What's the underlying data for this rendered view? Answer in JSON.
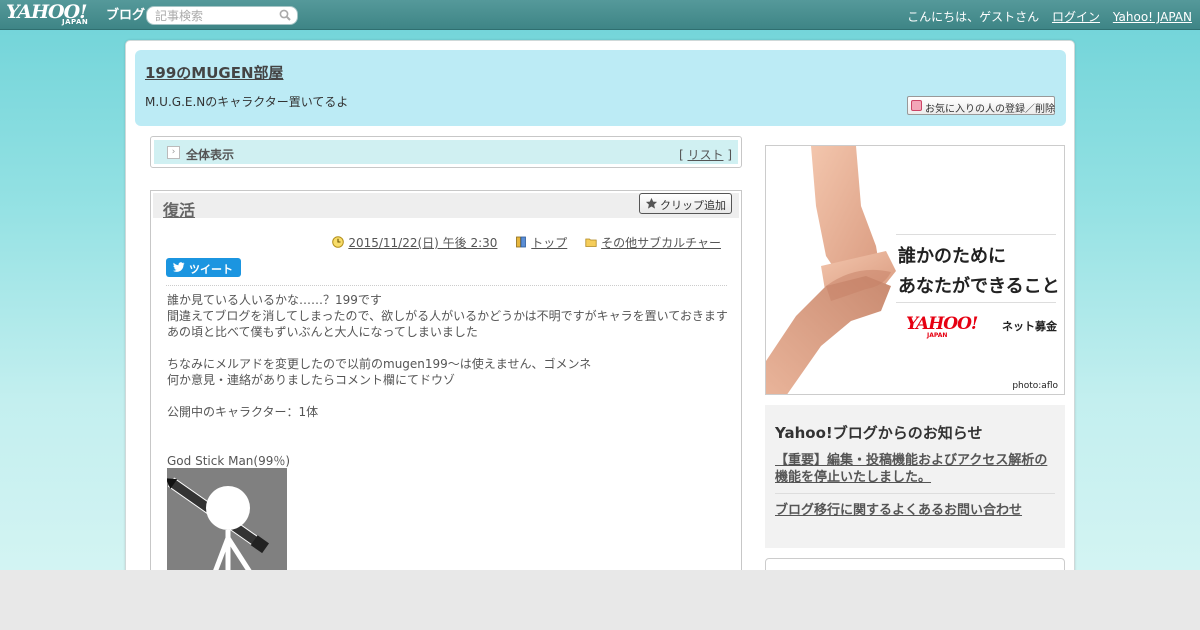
{
  "topbar": {
    "logo_text": "YAHOO!",
    "logo_sub": "JAPAN",
    "logo_blog": "ブログ",
    "search_placeholder": "記事検索",
    "greeting": "こんにちは、ゲストさん",
    "login": "ログイン",
    "yahoo_japan": "Yahoo! JAPAN"
  },
  "blog": {
    "title": "199のMUGEN部屋",
    "subtitle": "M.U.G.E.Nのキャラクター置いてるよ",
    "fav_button": "お気に入りの人の登録／削除"
  },
  "category_bar": {
    "label": "全体表示",
    "list_open": "[",
    "list_link": "リスト",
    "list_close": "]"
  },
  "post": {
    "title": "復活",
    "clip_button": "クリップ追加",
    "datetime": "2015/11/22(日) 午後 2:30",
    "top_link": "トップ",
    "category_link": "その他サブカルチャー",
    "tweet_button": "ツイート",
    "body_lines": [
      "誰か見ている人いるかな……？199です",
      "間違えてブログを消してしまったので、欲しがる人がいるかどうかは不明ですがキャラを置いておきます",
      "あの頃と比べて僕もずいぶんと大人になってしまいました",
      "",
      "ちなみにメルアドを変更したので以前のmugen199～は使えません、ゴメンネ",
      "何か意見・連絡がありましたらコメント欄にてドウゾ",
      "",
      "公開中のキャラクター：1体"
    ],
    "figure_caption": "God Stick Man(99％)"
  },
  "sidebar": {
    "ad": {
      "line1": "誰かのために",
      "line2": "あなたができること",
      "brand": "YAHOO!",
      "brand_sub": "JAPAN",
      "service": "ネット募金",
      "credit": "photo:aflo"
    },
    "notice": {
      "heading": "Yahoo!ブログからのお知らせ",
      "item1": "【重要】編集・投稿機能およびアクセス解析の機能を停止いたしました。",
      "item2": "ブログ移行に関するよくあるお問い合わせ"
    }
  },
  "colors": {
    "topbar": "#4a8f90",
    "header_box": "#bcebf5",
    "category_bar": "#d0f0f2",
    "tweet": "#1b95e0",
    "brand_red": "#e60012"
  }
}
